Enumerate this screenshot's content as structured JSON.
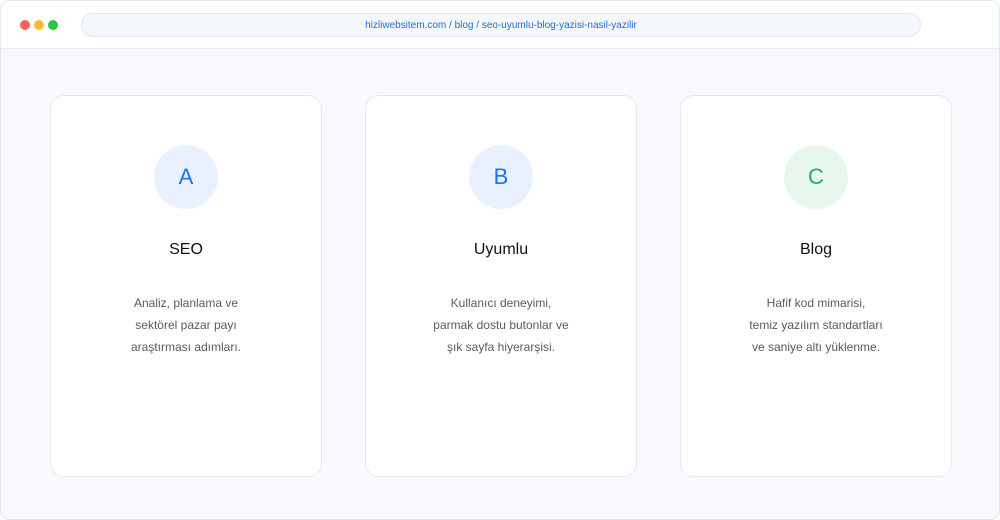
{
  "browser": {
    "url": "hizliwebsitem.com / blog / seo-uyumlu-blog-yazisi-nasil-yazilir"
  },
  "colors": {
    "accent_blue": "#1a73e8",
    "accent_green": "#1db45a"
  },
  "cards": [
    {
      "letter": "A",
      "title": "SEO",
      "lines": [
        "Analiz, planlama ve",
        "sektörel pazar payı",
        "araştırması adımları."
      ]
    },
    {
      "letter": "B",
      "title": "Uyumlu",
      "lines": [
        "Kullanıcı deneyimi,",
        "parmak dostu butonlar ve",
        "şık sayfa hiyerarşisi."
      ]
    },
    {
      "letter": "C",
      "title": "Blog",
      "lines": [
        "Hafif kod mimarisi,",
        "temiz yazılım standartları",
        "ve saniye altı yüklenme."
      ]
    }
  ]
}
